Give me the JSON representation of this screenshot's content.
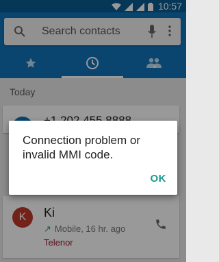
{
  "status_bar": {
    "time": "10:57",
    "icons": [
      "wifi-icon",
      "signal-icon",
      "signal-icon",
      "battery-icon"
    ]
  },
  "search": {
    "placeholder": "Search contacts"
  },
  "tabs": [
    {
      "name": "favorites",
      "icon": "star-icon",
      "selected": false
    },
    {
      "name": "recents",
      "icon": "clock-icon",
      "selected": true
    },
    {
      "name": "contacts",
      "icon": "people-icon",
      "selected": false
    }
  ],
  "list": {
    "section_label": "Today",
    "top_item": {
      "number": "+1 202 455 8888"
    },
    "contact": {
      "avatar_letter": "K",
      "name": "Ki",
      "call_detail": "Mobile, 16 hr. ago",
      "carrier": "Telenor"
    }
  },
  "dialog": {
    "message": "Connection problem or invalid MMI code.",
    "ok_label": "OK"
  },
  "colors": {
    "status_bar": "#0a5c91",
    "header": "#0f73b9",
    "accent": "#1a9a8f",
    "avatar_k": "#c0392b",
    "carrier_text": "#9b1b30"
  }
}
